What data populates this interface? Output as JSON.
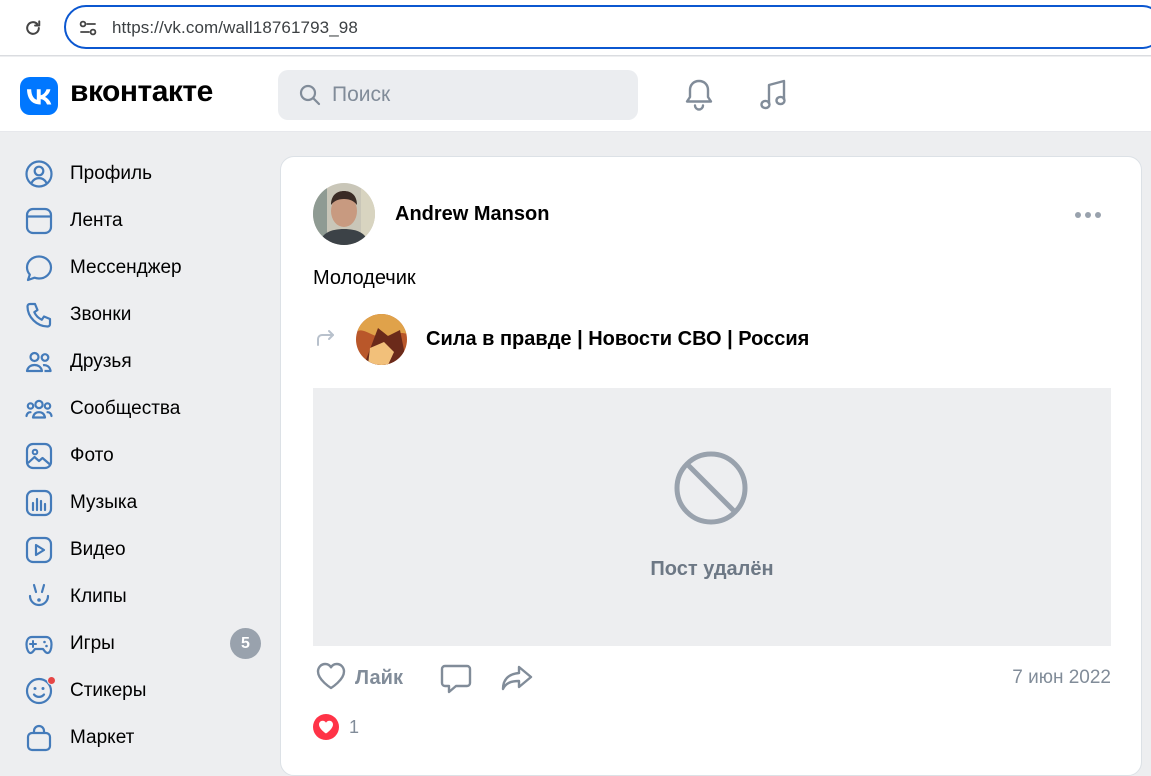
{
  "browser": {
    "url": "https://vk.com/wall18761793_98"
  },
  "header": {
    "brand": "вконтакте",
    "search_placeholder": "Поиск"
  },
  "sidebar": {
    "items": [
      {
        "label": "Профиль",
        "icon": "profile-icon"
      },
      {
        "label": "Лента",
        "icon": "feed-icon"
      },
      {
        "label": "Мессенджер",
        "icon": "messenger-icon"
      },
      {
        "label": "Звонки",
        "icon": "phone-icon"
      },
      {
        "label": "Друзья",
        "icon": "friends-icon"
      },
      {
        "label": "Сообщества",
        "icon": "communities-icon"
      },
      {
        "label": "Фото",
        "icon": "photo-icon"
      },
      {
        "label": "Музыка",
        "icon": "music-icon"
      },
      {
        "label": "Видео",
        "icon": "video-icon"
      },
      {
        "label": "Клипы",
        "icon": "clips-icon"
      },
      {
        "label": "Игры",
        "icon": "games-icon",
        "badge": "5"
      },
      {
        "label": "Стикеры",
        "icon": "stickers-icon"
      },
      {
        "label": "Маркет",
        "icon": "market-icon"
      }
    ]
  },
  "post": {
    "author": "Andrew Manson",
    "text": "Молодечик",
    "repost_source": "Сила в правде | Новости СВО | Россия",
    "deleted_message": "Пост удалён",
    "like_label": "Лайк",
    "date": "7 июн 2022",
    "likes_count": "1"
  },
  "colors": {
    "vk_blue": "#0077ff",
    "badge_gray": "#99a2ad",
    "like_red": "#ff3347",
    "muted_text": "#818c99"
  }
}
